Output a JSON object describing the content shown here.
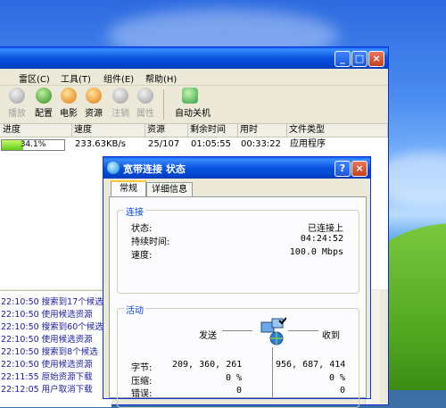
{
  "main_window": {
    "title_buttons": {
      "minimize": "_",
      "maximize": "□",
      "close": "×"
    },
    "menu": [
      "雷区(C)",
      "工具(T)",
      "组件(E)",
      "帮助(H)"
    ],
    "toolbar": [
      {
        "label": "播放",
        "icon": "play-icon",
        "disabled": true,
        "color": "#9a9a9a"
      },
      {
        "label": "配置",
        "icon": "config-icon",
        "disabled": false,
        "color": "#3a8a2a"
      },
      {
        "label": "电影",
        "icon": "movie-icon",
        "disabled": false,
        "color": "#e07a10"
      },
      {
        "label": "资源",
        "icon": "resource-icon",
        "disabled": false,
        "color": "#e07a10"
      },
      {
        "label": "注销",
        "icon": "logout-icon",
        "disabled": true,
        "color": "#9a9a9a"
      },
      {
        "label": "属性",
        "icon": "properties-icon",
        "disabled": true,
        "color": "#9a9a9a"
      },
      {
        "label": "自动关机",
        "icon": "auto-shutdown-icon",
        "disabled": false,
        "color": "#2aa040"
      }
    ],
    "columns": [
      "进度",
      "速度",
      "资源",
      "剩余时间",
      "用时",
      "文件类型"
    ],
    "rows": [
      {
        "progress": "34.1%",
        "progress_value": 0.341,
        "speed": "233.63KB/s",
        "resources": "25/107",
        "remaining": "01:05:55",
        "elapsed": "00:33:22",
        "file_type": "应用程序"
      }
    ],
    "log": [
      "22:10:50 搜索到17个候选",
      "22:10:50 使用候选资源",
      "22:10:50 搜索到60个候选",
      "22:10:50 使用候选资源",
      "22:10:50 搜索到8个候选",
      "22:10:50 使用候选资源",
      "22:11:55 原始资源下载",
      "22:12:05 用户取消下载"
    ]
  },
  "status_dialog": {
    "title": "宽带连接 状态",
    "help_button": "?",
    "close_button": "×",
    "tabs": [
      "常规",
      "详细信息"
    ],
    "connection": {
      "group_label": "连接",
      "rows": [
        {
          "label": "状态:",
          "value": "已连接上"
        },
        {
          "label": "持续时间:",
          "value": "04:24:52"
        },
        {
          "label": "速度:",
          "value": "100.0 Mbps"
        }
      ]
    },
    "activity": {
      "group_label": "活动",
      "sent_label": "发送",
      "received_label": "收到",
      "rows": [
        {
          "label": "字节:",
          "sent": "209, 360, 261",
          "received": "956, 687, 414"
        },
        {
          "label": "压缩:",
          "sent": "0 %",
          "received": "0 %"
        },
        {
          "label": "错误:",
          "sent": "0",
          "received": "0"
        }
      ]
    }
  },
  "colors": {
    "xp_blue": "#0a53e0",
    "progress_green": "#5fcf1a",
    "link_blue": "#0046d5",
    "log_text": "#2020a0"
  }
}
